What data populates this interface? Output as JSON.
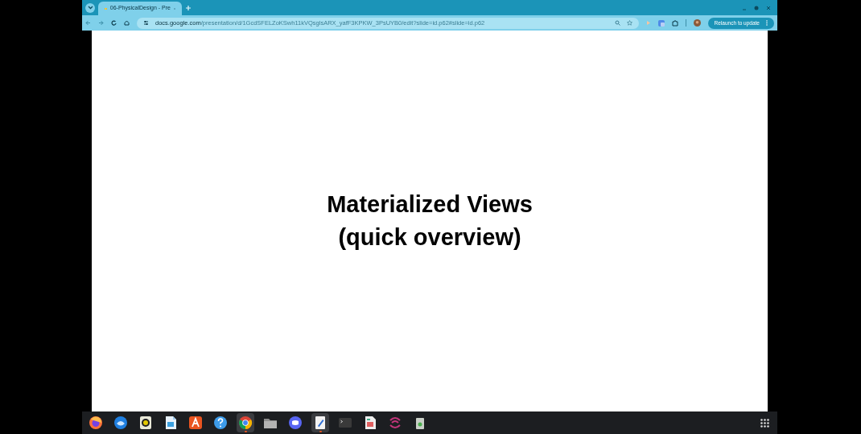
{
  "browser": {
    "tab": {
      "title": "06-PhysicalDesign - Pre",
      "selected": true
    },
    "address": {
      "host": "docs.google.com",
      "path": "/presentation/d/1GcdSFELZoKSwh11kVQsglsARX_yafF3KPKW_3PsUYB0/edit?slide=id.p62#slide=id.p62"
    },
    "relaunch_button": "Relaunch to update"
  },
  "slide": {
    "lines": [
      "Materialized Views",
      "(quick overview)"
    ]
  },
  "dock": {
    "items": [
      {
        "kind": "firefox",
        "running": false
      },
      {
        "kind": "thunderbird",
        "running": false
      },
      {
        "kind": "speaker",
        "running": false
      },
      {
        "kind": "document",
        "running": false
      },
      {
        "kind": "store",
        "running": false
      },
      {
        "kind": "help",
        "running": false
      },
      {
        "kind": "chrome",
        "running": true
      },
      {
        "kind": "folder",
        "running": false
      },
      {
        "kind": "chat",
        "running": false
      },
      {
        "kind": "editor",
        "running": true
      },
      {
        "kind": "terminal",
        "running": false
      },
      {
        "kind": "sheet",
        "running": false
      },
      {
        "kind": "swirl",
        "running": false
      },
      {
        "kind": "trash",
        "running": false
      }
    ]
  }
}
